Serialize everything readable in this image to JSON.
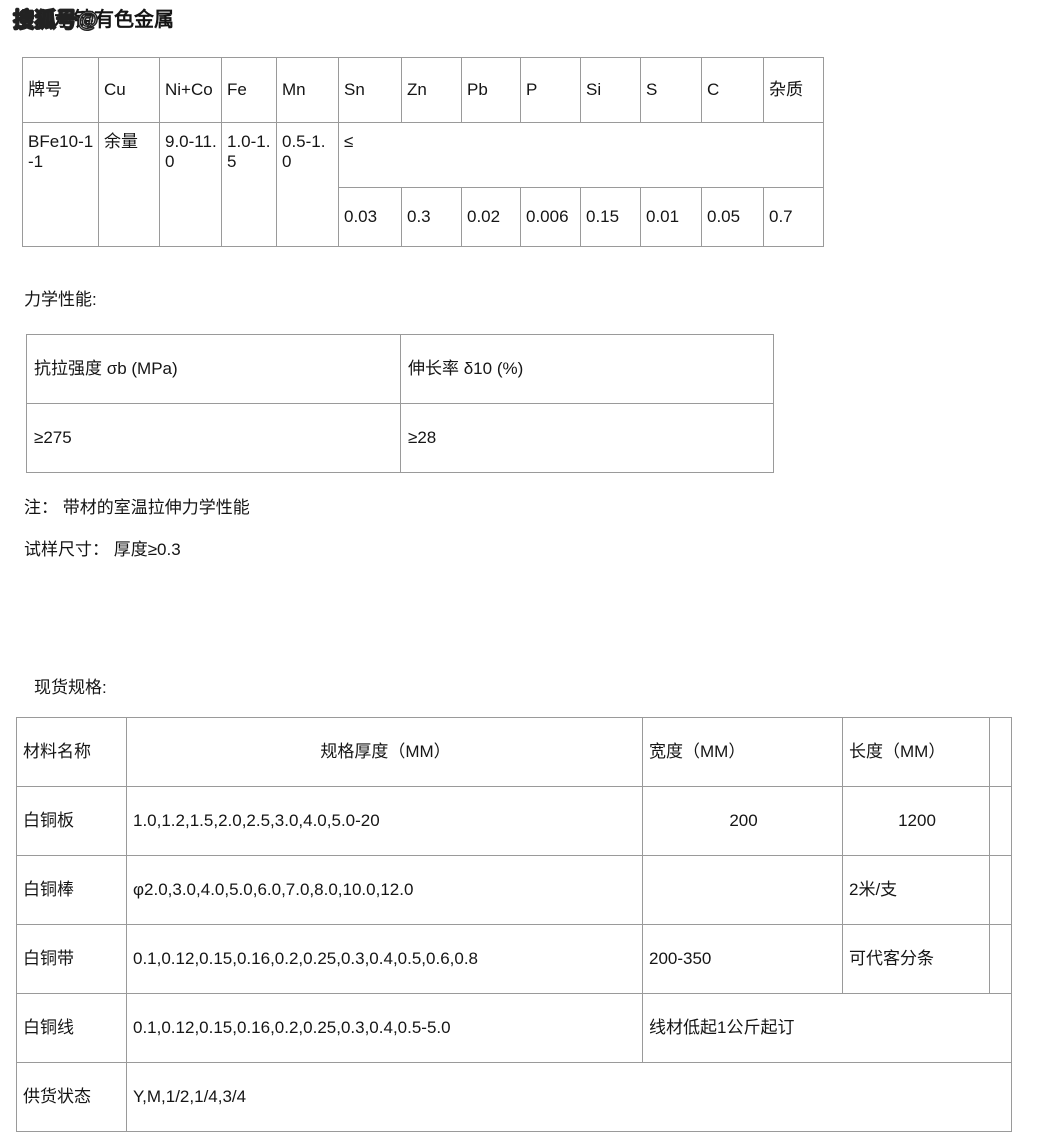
{
  "watermark": {
    "overlay_text": "搜狐号@",
    "base_text": "上海承铸有色金属"
  },
  "composition_table": {
    "headers": [
      "牌号",
      "Cu",
      "Ni+Co",
      "Fe",
      "Mn",
      "Sn",
      "Zn",
      "Pb",
      "P",
      "Si",
      "S",
      "C",
      "杂质"
    ],
    "row": {
      "brand": "BFe10-1-1",
      "cu": "余量",
      "nico": "9.0-11.0",
      "fe": "1.0-1.5",
      "mn": "0.5-1.0",
      "limit_symbol": "≤",
      "limits": [
        "0.03",
        "0.3",
        "0.02",
        "0.006",
        "0.15",
        "0.01",
        "0.05",
        "0.7"
      ]
    }
  },
  "mechanical": {
    "label": "力学性能:",
    "headers": [
      "抗拉强度 σb (MPa)",
      "伸长率 δ10 (%)"
    ],
    "values": [
      "≥275",
      "≥28"
    ],
    "note_1": "注： 带材的室温拉伸力学性能",
    "note_2": "试样尺寸： 厚度≥0.3"
  },
  "stock": {
    "label": "现货规格:",
    "headers": [
      "材料名称",
      "规格厚度（MM）",
      "宽度（MM）",
      "长度（MM）"
    ],
    "rows": [
      {
        "name": "白铜板",
        "thickness": "1.0,1.2,1.5,2.0,2.5,3.0,4.0,5.0-20",
        "width": "200",
        "length": "1200"
      },
      {
        "name": "白铜棒",
        "thickness": "φ2.0,3.0,4.0,5.0,6.0,7.0,8.0,10.0,12.0",
        "width": "",
        "length": "2米/支"
      },
      {
        "name": "白铜带",
        "thickness": "0.1,0.12,0.15,0.16,0.2,0.25,0.3,0.4,0.5,0.6,0.8",
        "width": "200-350",
        "length": "可代客分条"
      },
      {
        "name": "白铜线",
        "thickness": "0.1,0.12,0.15,0.16,0.2,0.25,0.3,0.4,0.5-5.0",
        "width_merged": "线材低起1公斤起订"
      },
      {
        "name": "供货状态",
        "thickness_merged": "Y,M,1/2,1/4,3/4"
      }
    ]
  }
}
